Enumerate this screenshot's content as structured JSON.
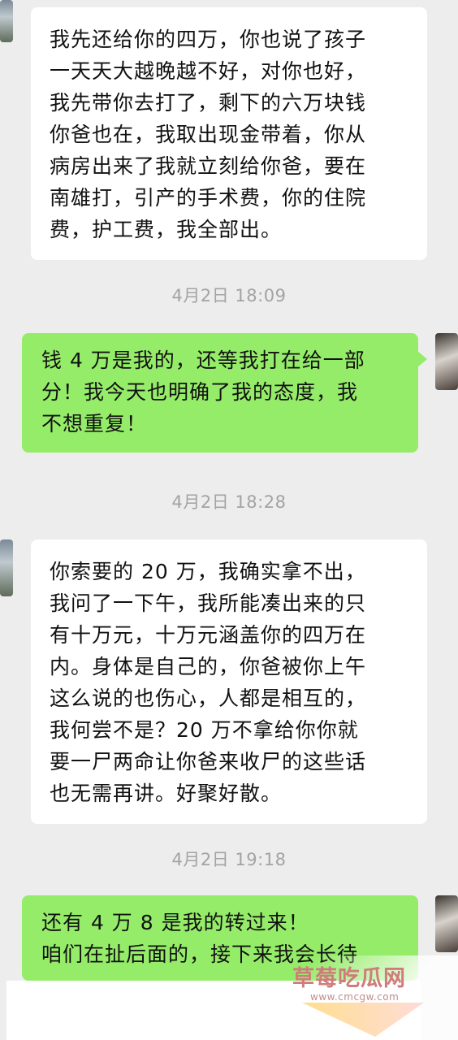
{
  "messages": [
    {
      "type": "received",
      "text": "我先还给你的四万，你也说了孩子\n一天天大越晚越不好，对你也好，\n我先带你去打了，剩下的六万块钱\n你爸也在，我取出现金带着，你从\n病房出来了我就立刻给你爸，要在\n南雄打，引产的手术费，你的住院\n费，护工费，我全部出。"
    },
    {
      "type": "time",
      "text": "4月2日 18:09"
    },
    {
      "type": "sent",
      "text": "钱 4 万是我的，还等我打在给一部\n分！我今天也明确了我的态度，我\n不想重复！"
    },
    {
      "type": "time",
      "text": "4月2日 18:28"
    },
    {
      "type": "received",
      "text": "你索要的 20 万，我确实拿不出，\n我问了一下午，我所能凑出来的只\n有十万元，十万元涵盖你的四万在\n内。身体是自己的，你爸被你上午\n这么说的也伤心，人都是相互的，\n我何尝不是？20 万不拿给你你就\n要一尸两命让你爸来收尸的这些话\n也无需再讲。好聚好散。"
    },
    {
      "type": "time",
      "text": "4月2日 19:18"
    },
    {
      "type": "sent",
      "text": "还有 4 万 8 是我的转过来！\n咱们在扯后面的，接下来我会长待"
    }
  ],
  "watermark": {
    "title": "草莓吃瓜网",
    "url": "www.cmcgw.com"
  },
  "icons": {
    "received_avatar": "contact-avatar",
    "sent_avatar": "self-avatar"
  }
}
